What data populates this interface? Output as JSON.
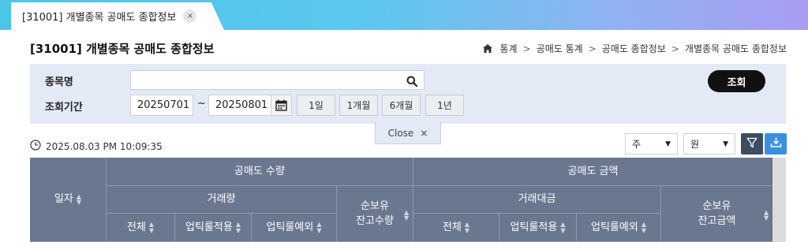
{
  "tab": {
    "label": "[31001] 개별종목 공매도 종합정보",
    "close": "×"
  },
  "header": {
    "title": "[31001] 개별종목 공매도 종합정보",
    "breadcrumb": [
      "통계",
      "공매도 통계",
      "공매도 종합정보",
      "개별종목 공매도 종합정보"
    ],
    "breadcrumb_sep": ">"
  },
  "search": {
    "stock_label": "종목명",
    "stock_value": "",
    "stock_placeholder": "",
    "period_label": "조회기간",
    "start_date": "20250701",
    "tilde": "~",
    "end_date": "20250801",
    "period_buttons": [
      "1일",
      "1개월",
      "6개월",
      "1년"
    ],
    "query_label": "조회",
    "close_label": "Close",
    "close_x": "×"
  },
  "toolbar": {
    "timestamp": "2025.08.03 PM 10:09:35",
    "period_unit": "주",
    "currency_unit": "원"
  },
  "table": {
    "date_col": "일자",
    "qty_group": "공매도 수량",
    "amt_group": "공매도 금액",
    "volume": "거래량",
    "trade_value": "거래대금",
    "net_balance_qty_line1": "순보유",
    "net_balance_qty_line2": "잔고수량",
    "net_balance_amt_line1": "순보유",
    "net_balance_amt_line2": "잔고금액",
    "total": "전체",
    "uptick_applied": "업틱룰적용",
    "uptick_exempt": "업틱룰예외"
  },
  "colors": {
    "tab_gradient_start": "#49c6e9",
    "tab_gradient_end": "#a99cf3",
    "panel_bg": "#e4e9f6",
    "table_header_bg": "#6a788f",
    "download_button": "#3b8fe0",
    "filter_button": "#3d4b63"
  }
}
